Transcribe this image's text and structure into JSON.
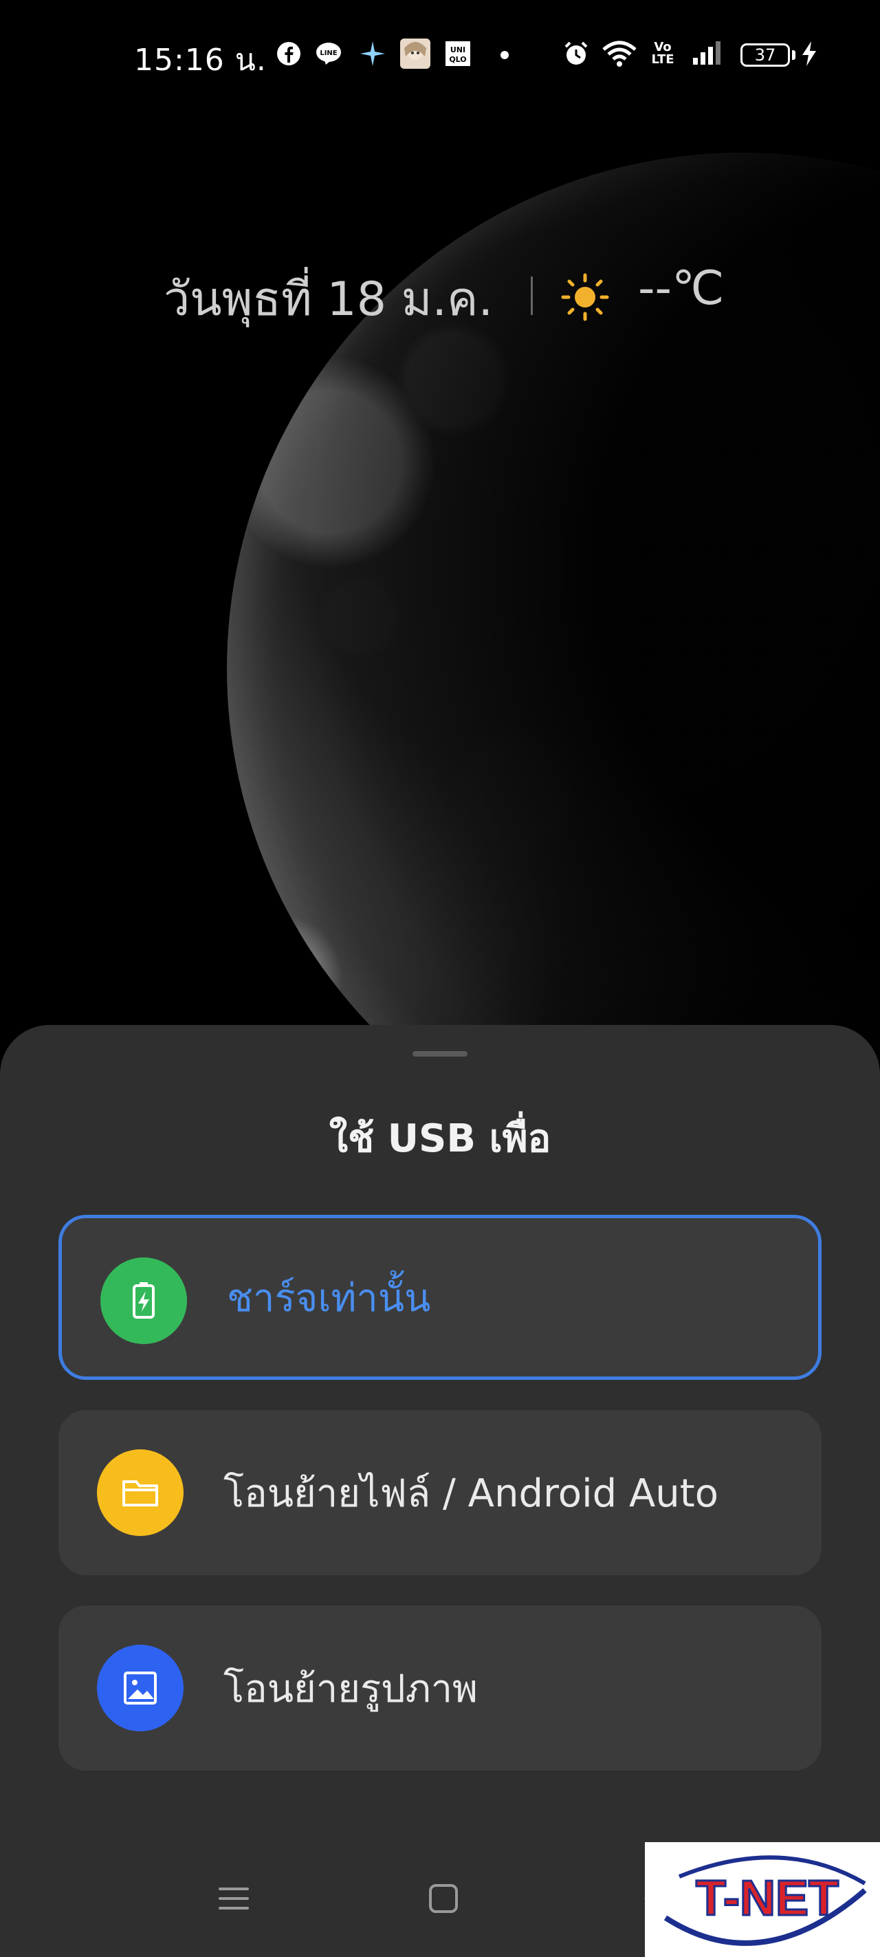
{
  "status_bar": {
    "time": "15:16 น.",
    "volte": "Vo LTE",
    "battery_level": "37",
    "icons": [
      "facebook-icon",
      "line-icon",
      "sparkle-icon",
      "avatar-icon",
      "uniqlo-icon",
      "dot-icon",
      "alarm-icon",
      "wifi-icon",
      "volte-icon",
      "signal-icon",
      "battery-icon",
      "charging-bolt-icon"
    ]
  },
  "lock_screen": {
    "date": "วันพุธที่ 18 ม.ค.",
    "temperature": "--℃",
    "weather_icon": "sun-icon"
  },
  "usb_sheet": {
    "title": "ใช้ USB เพื่อ",
    "options": [
      {
        "label": "ชาร์จเท่านั้น",
        "icon": "battery-charging-icon",
        "color": "#34b95a",
        "selected": true
      },
      {
        "label": "โอนย้ายไฟล์ / Android Auto",
        "icon": "folder-icon",
        "color": "#f7bd1c",
        "selected": false
      },
      {
        "label": "โอนย้ายรูปภาพ",
        "icon": "image-icon",
        "color": "#2e63f2",
        "selected": false
      }
    ],
    "accent": "#3f7de0"
  },
  "nav_bar": {
    "buttons": [
      "menu-icon",
      "home-icon",
      "back-icon"
    ]
  },
  "watermark": {
    "text": "T-NET"
  }
}
